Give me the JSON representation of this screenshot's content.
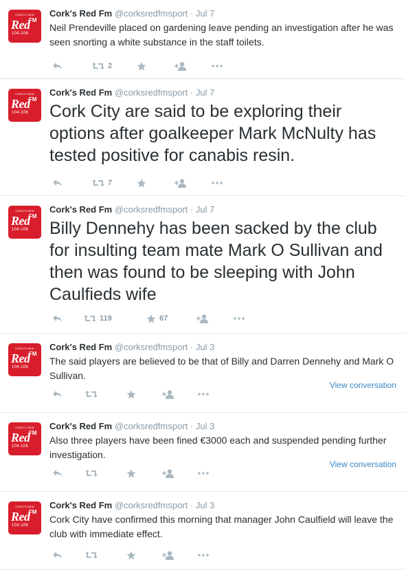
{
  "account": {
    "name": "Cork's Red Fm",
    "handle": "@corksredfmsport",
    "avatar": {
      "top": "CORK'S NEW",
      "brand": "Red",
      "fm": "FM",
      "freq": "104-106"
    }
  },
  "sep": "·",
  "tweets": [
    {
      "date": "Jul 7",
      "text": "Neil Prendeville placed on gardening leave pending an investigation after he was seen snorting a white substance in the staff toilets.",
      "retweets": "2",
      "favorites": "",
      "view": ""
    },
    {
      "date": "Jul 7",
      "text": "Cork City are said to be exploring their options after goalkeeper Mark McNulty has tested positive for canabis resin.",
      "retweets": "7",
      "favorites": "",
      "view": ""
    },
    {
      "date": "Jul 7",
      "text": "Billy Dennehy has been sacked by the club for insulting team mate Mark O Sullivan and then was found to be sleeping with John Caulfieds wife",
      "retweets": "119",
      "favorites": "67",
      "view": ""
    },
    {
      "date": "Jul 3",
      "text": "The said players are believed to be that of Billy and Darren Dennehy and Mark O Sullivan.",
      "retweets": "",
      "favorites": "",
      "view": "View conversation"
    },
    {
      "date": "Jul 3",
      "text": "Also three players have been fined €3000 each and suspended pending further investigation.",
      "retweets": "",
      "favorites": "",
      "view": "View conversation"
    },
    {
      "date": "Jul 3",
      "text": "Cork City have confirmed this morning that manager John Caulfield will leave the club with immediate effect.",
      "retweets": "",
      "favorites": "",
      "view": ""
    }
  ]
}
